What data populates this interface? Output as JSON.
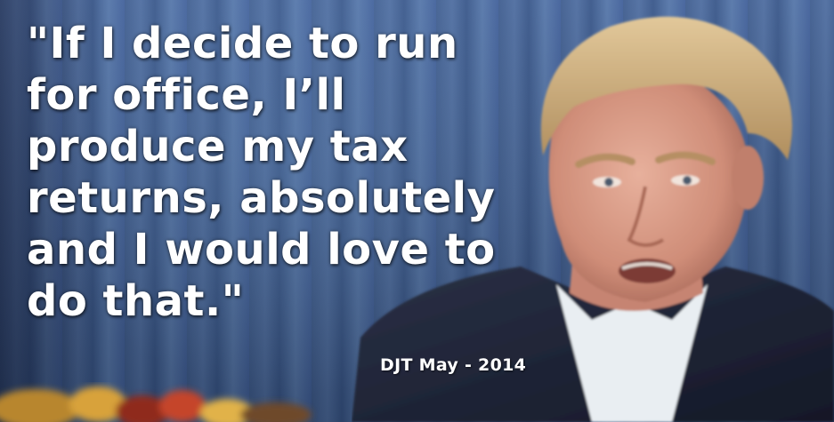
{
  "quote": {
    "lines": "\"If I decide to run\nfor office, I’ll\nproduce my tax\nreturns, absolutely\nand I would love to\ndo that.\""
  },
  "attribution": {
    "text": "DJT May - 2014"
  },
  "colors": {
    "background_curtain": "#3f5d8f",
    "text": "#ffffff",
    "suit": "#1c2233",
    "hair": "#c9ac7d",
    "skin": "#d79a85",
    "shirt": "#e9eef2"
  }
}
